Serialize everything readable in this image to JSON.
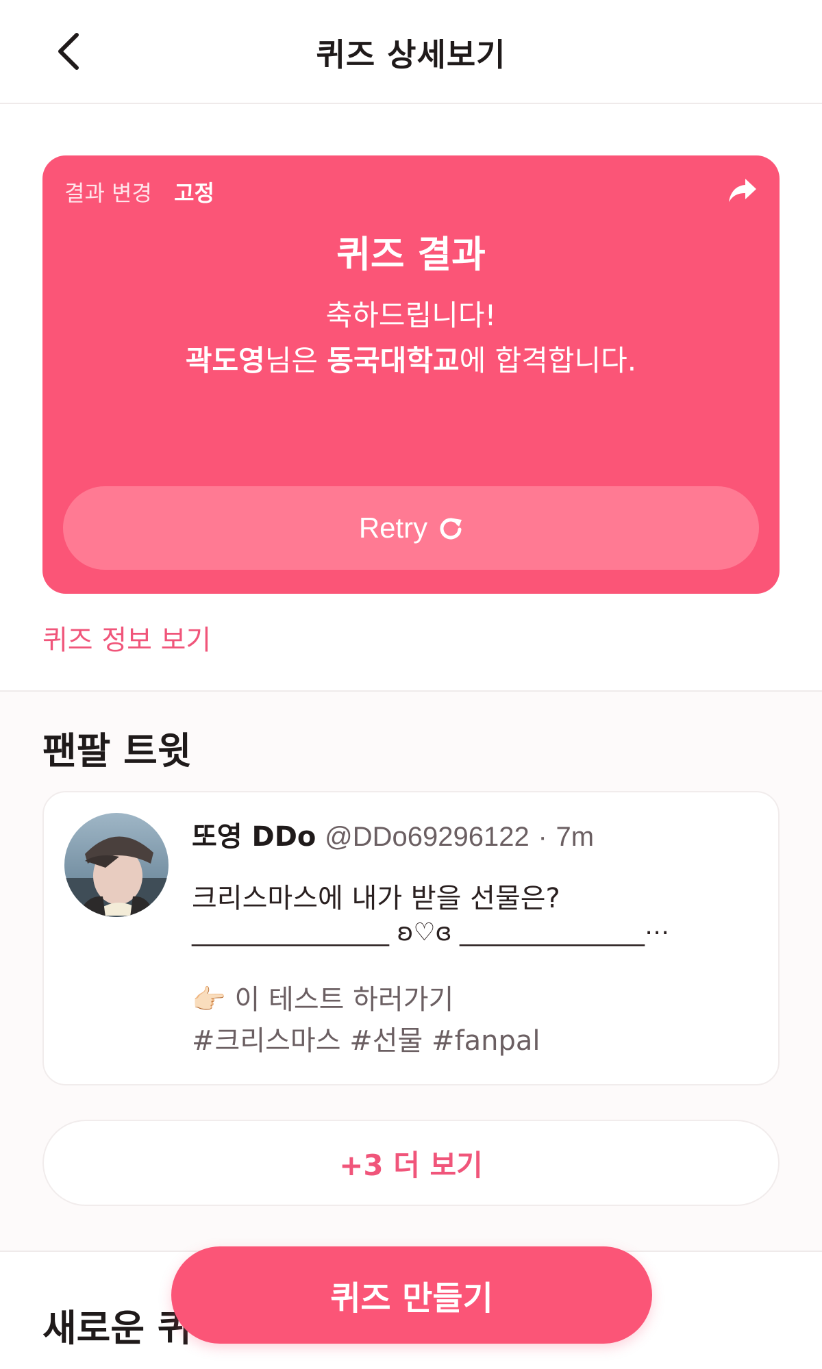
{
  "header": {
    "title": "퀴즈 상세보기",
    "back_icon": "chevron-left-icon"
  },
  "result_card": {
    "change_label": "결과 변경",
    "fix_label": "고정",
    "share_icon": "share-arrow-icon",
    "title": "퀴즈 결과",
    "line1": "축하드립니다!",
    "line2_name": "곽도영",
    "line2_mid": "님은 ",
    "line2_school": "동국대학교",
    "line2_end": "에 합격합니다.",
    "retry_label": "Retry",
    "retry_icon": "refresh-icon"
  },
  "quiz_info_link": "퀴즈 정보 보기",
  "fanpal_tweet": {
    "section_title": "팬팔 트윗",
    "tweet": {
      "name": "또영 DDo",
      "handle": "@DDo69296122",
      "time": "7m",
      "line1": "크리스마스에 내가 받을 선물은?",
      "line2": "________________ ʚ♡ɞ _______________⋯",
      "line3": "👉🏻 이 테스트 하러가기",
      "line4": "#크리스마스 #선물 #fanpal"
    },
    "more_label": "+3 더 보기"
  },
  "new_quiz": {
    "section_title": "새로운 퀴"
  },
  "fab": {
    "label": "퀴즈 만들기"
  },
  "colors": {
    "accent": "#fb5577",
    "accent_light": "#ff7a93",
    "link": "#f0557a"
  }
}
